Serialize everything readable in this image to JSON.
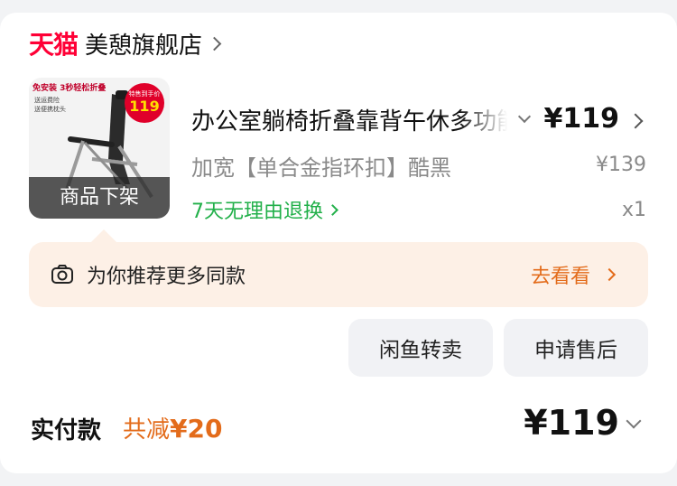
{
  "shop": {
    "logo_text": "天猫",
    "name": "美憩旗舰店"
  },
  "product": {
    "image": {
      "promo_top": "免安装 3秒轻松折叠",
      "promo_lines": [
        "送运费险",
        "送便携枕头"
      ],
      "badge_top": "特售到手价",
      "badge_price": "119",
      "overlay": "商品下架"
    },
    "title": "办公室躺椅折叠靠背午休多功能",
    "spec": "加宽【单合金指环扣】酷黑",
    "return_policy": "7天无理由退换",
    "price": "¥119",
    "original_price": "¥139",
    "quantity": "x1"
  },
  "recommend": {
    "text": "为你推荐更多同款",
    "action": "去看看"
  },
  "buttons": {
    "resell": "闲鱼转卖",
    "after_sale": "申请售后"
  },
  "total": {
    "label": "实付款",
    "discount_prefix": "共减",
    "discount_amount": "¥20",
    "amount": "¥119"
  },
  "colors": {
    "tmall_red": "#ff0036",
    "accent_orange": "#e36b1a",
    "green": "#22b04a"
  }
}
